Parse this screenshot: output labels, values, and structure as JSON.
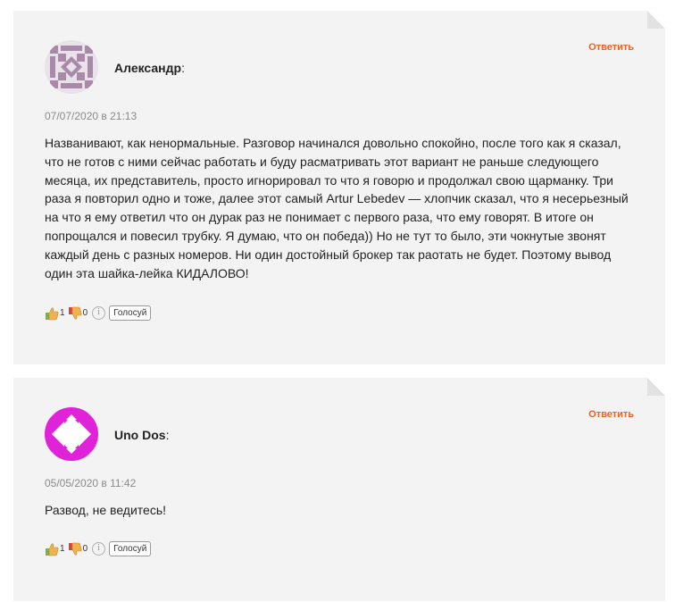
{
  "comments": [
    {
      "author": "Александр",
      "colon": ":",
      "reply_label": "Ответить",
      "date": "07/07/2020 в 21:13",
      "text": "Названивают, как ненормальные. Разговор начинался довольно спокойно, после того как я сказал, что не готов с ними сейчас работать и буду расматривать этот вариант не раньше следующего месяца, их представитель, просто игнорировал то что я говорю и продолжал свою щарманку. Три раза я повторил одно и тоже, далее этот самый Artur Lebedev — хлопчик сказал, что я несерьезный на что я ему ответил что он дурак раз не понимает с первого раза, что ему говорят. В итоге он попрощался и повесил трубку. Я думаю, что он победа)) Но не тут то было, эти чокнутые звонят каждый день с разных номеров. Ни один достойный брокер так раотать не будет. Поэтому вывод один эта шайка-лейка КИДАЛОВО!",
      "likes": "1",
      "dislikes": "0",
      "vote_label": "Голосуй",
      "avatar_icon": "identicon-purple"
    },
    {
      "author": "Uno Dos",
      "colon": ":",
      "reply_label": "Ответить",
      "date": "05/05/2020 в 11:42",
      "text": "Развод, не ведитесь!",
      "likes": "1",
      "dislikes": "0",
      "vote_label": "Голосуй",
      "avatar_icon": "identicon-magenta"
    }
  ],
  "colors": {
    "reply": "#e8632b",
    "panel": "#f3f3f3",
    "avatar1": "#a88aa8",
    "avatar2": "#e022d8"
  }
}
